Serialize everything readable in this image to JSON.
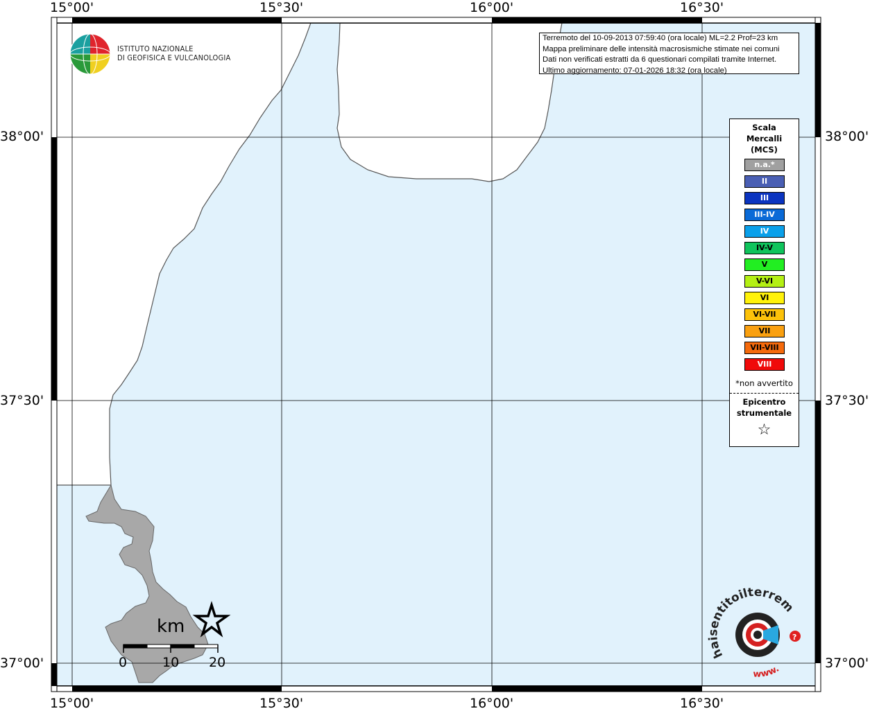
{
  "map": {
    "lon_labels": [
      "15°00'",
      "15°30'",
      "16°00'",
      "16°30'"
    ],
    "lat_labels": [
      "38°00'",
      "37°30'",
      "37°00'"
    ],
    "colors": {
      "sea": "#e1f2fc",
      "land": "#ffffff",
      "affected_land": "#a8a8a8",
      "coastline": "#555555"
    }
  },
  "institute": {
    "name_line1": "ISTITUTO NAZIONALE",
    "name_line2": "DI GEOFISICA E VULCANOLOGIA",
    "icon": "ingv-globe-logo"
  },
  "info": {
    "line1": "Terremoto del 10-09-2013 07:59:40 (ora locale) ML=2.2 Prof=23 km",
    "line2": "Mappa preliminare delle intensità macrosismiche stimate nei comuni",
    "line3": "Dati non verificati estratti da 6 questionari compilati tramite Internet.",
    "line4": "Ultimo aggiornamento: 07-01-2026 18:32 (ora locale)"
  },
  "legend": {
    "title_line1": "Scala",
    "title_line2": "Mercalli",
    "title_line3": "(MCS)",
    "items": [
      {
        "label": "n.a.*",
        "color": "#a0a0a0",
        "text_color": "#ffffff"
      },
      {
        "label": "II",
        "color": "#4a5fb4",
        "text_color": "#ffffff"
      },
      {
        "label": "III",
        "color": "#0b34c0",
        "text_color": "#ffffff"
      },
      {
        "label": "III-IV",
        "color": "#0a6ad7",
        "text_color": "#ffffff"
      },
      {
        "label": "IV",
        "color": "#0aa0ea",
        "text_color": "#ffffff"
      },
      {
        "label": "IV-V",
        "color": "#10c45c",
        "text_color": "#000000"
      },
      {
        "label": "V",
        "color": "#22ee22",
        "text_color": "#000000"
      },
      {
        "label": "V-VI",
        "color": "#b4f014",
        "text_color": "#000000"
      },
      {
        "label": "VI",
        "color": "#fff20a",
        "text_color": "#000000"
      },
      {
        "label": "VI-VII",
        "color": "#fcc20a",
        "text_color": "#000000"
      },
      {
        "label": "VII",
        "color": "#faa010",
        "text_color": "#000000"
      },
      {
        "label": "VII-VIII",
        "color": "#f56a0c",
        "text_color": "#000000"
      },
      {
        "label": "VIII",
        "color": "#f00a0a",
        "text_color": "#ffffff"
      }
    ],
    "na_note": "*non avvertito",
    "epicenter_line1": "Epicentro",
    "epicenter_line2": "strumentale",
    "epicenter_icon": "star-outline-icon"
  },
  "scalebar": {
    "unit": "km",
    "ticks": [
      "0",
      "10",
      "20"
    ]
  },
  "epicenter_marker": {
    "icon": "star-icon"
  },
  "website_logo": {
    "text": "www.haisentitoilterremoto.it",
    "icon": "haisentito-logo"
  }
}
